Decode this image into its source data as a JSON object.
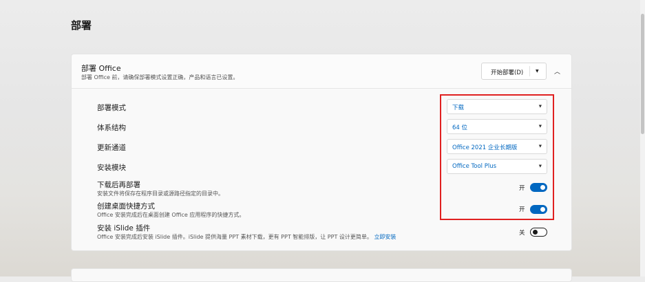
{
  "page": {
    "title": "部署"
  },
  "deploy_card": {
    "title": "部署 Office",
    "description": "部署 Office 前，请确保部署模式设置正确，产品和语言已设置。",
    "deploy_button": "开始部署(D)",
    "collapse_icon": "chevron-up-icon"
  },
  "settings": {
    "mode": {
      "label": "部署模式",
      "value": "下载"
    },
    "arch": {
      "label": "体系结构",
      "value": "64 位"
    },
    "channel": {
      "label": "更新通道",
      "value": "Office 2021 企业长期版"
    },
    "module": {
      "label": "安装模块",
      "value": "Office Tool Plus"
    },
    "deploy_after_download": {
      "label": "下载后再部署",
      "desc": "安装文件将保存在程序目录或源路径指定的目录中。",
      "state": "开"
    },
    "desktop_shortcut": {
      "label": "创建桌面快捷方式",
      "desc": "Office 安装完成后在桌面创建 Office 应用程序的快捷方式。",
      "state": "开"
    },
    "islide": {
      "label": "安装 iSlide 插件",
      "desc": "Office 安装完成后安装 iSlide 插件。iSlide 提供海量 PPT 素材下载，更有 PPT 智能排版，让 PPT 设计更简单。",
      "link": "立即安装",
      "state": "关"
    }
  },
  "colors": {
    "accent": "#0067c0",
    "highlight": "#e02020"
  }
}
